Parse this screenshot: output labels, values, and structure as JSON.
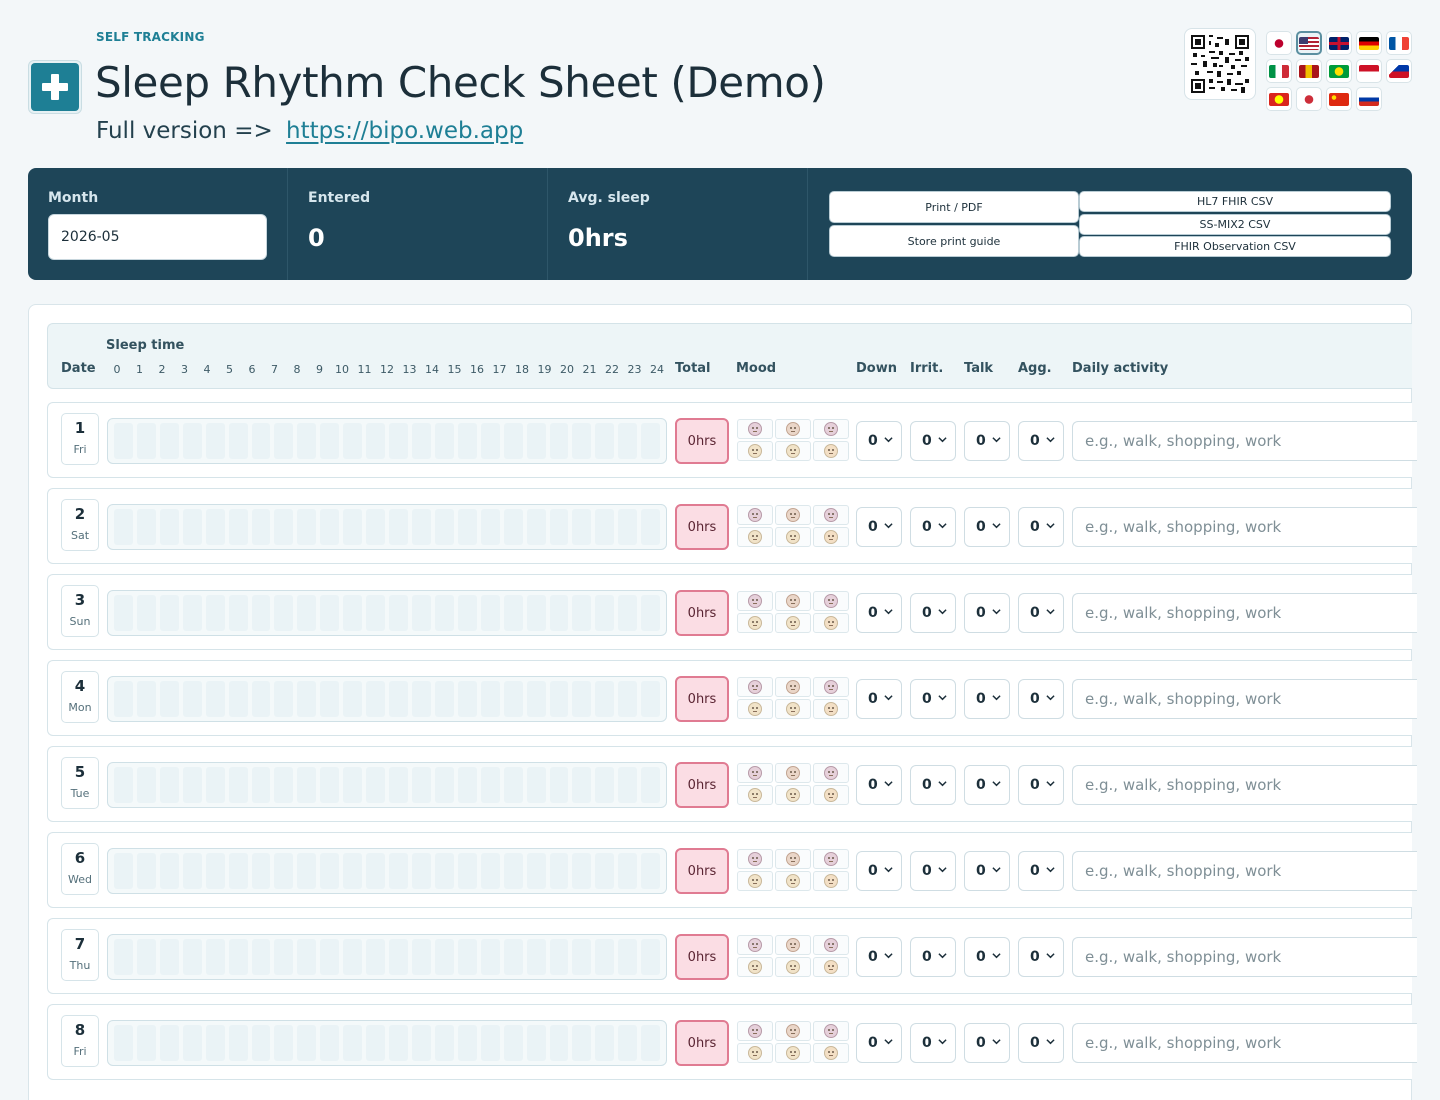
{
  "header": {
    "eyebrow": "SELF TRACKING",
    "title": "Sleep Rhythm Check Sheet (Demo)",
    "subtitle_prefix": "Full version =>",
    "subtitle_link": "https://bipo.web.app"
  },
  "languages": [
    {
      "code": "ja",
      "colors": [
        "#ffffff",
        "#bc002d"
      ]
    },
    {
      "code": "en-US",
      "colors": [
        "#b22234",
        "#3c3b6e"
      ],
      "selected": true
    },
    {
      "code": "en-GB",
      "colors": [
        "#012169",
        "#c8102e"
      ]
    },
    {
      "code": "de",
      "colors": [
        "#000000",
        "#dd0000",
        "#ffce00"
      ]
    },
    {
      "code": "fr",
      "colors": [
        "#0055a4",
        "#ffffff",
        "#ef4135"
      ]
    },
    {
      "code": "it",
      "colors": [
        "#009246",
        "#ffffff",
        "#ce2b37"
      ]
    },
    {
      "code": "es",
      "colors": [
        "#aa151b",
        "#f1bf00",
        "#aa151b"
      ]
    },
    {
      "code": "pt-BR",
      "colors": [
        "#009c3b",
        "#ffdf00"
      ]
    },
    {
      "code": "id",
      "colors": [
        "#ce1126",
        "#ffffff"
      ]
    },
    {
      "code": "fil",
      "colors": [
        "#0038a8",
        "#ce1126"
      ]
    },
    {
      "code": "vi",
      "colors": [
        "#da251d",
        "#ffff00"
      ]
    },
    {
      "code": "ko",
      "colors": [
        "#ffffff",
        "#cd2e3a"
      ]
    },
    {
      "code": "zh",
      "colors": [
        "#de2910",
        "#ffde00"
      ]
    },
    {
      "code": "ru",
      "colors": [
        "#ffffff",
        "#0039a6",
        "#d52b1e"
      ]
    }
  ],
  "summary": {
    "month_label": "Month",
    "month_value": "2026-05",
    "entered_label": "Entered",
    "entered_value": "0",
    "avg_label": "Avg. sleep",
    "avg_value": "0hrs",
    "buttons": {
      "print_pdf": "Print / PDF",
      "store_print_guide": "Store print guide",
      "hl7_fhir_csv": "HL7 FHIR CSV",
      "ss_mix2_csv": "SS-MIX2 CSV",
      "fhir_observation_csv": "FHIR Observation CSV"
    }
  },
  "table": {
    "headers": {
      "date": "Date",
      "sleep_time": "Sleep time",
      "total": "Total",
      "mood": "Mood",
      "down": "Down",
      "irrit": "Irrit.",
      "talk": "Talk",
      "agg": "Agg.",
      "daily_activity": "Daily activity"
    },
    "hours": [
      "0",
      "1",
      "2",
      "3",
      "4",
      "5",
      "6",
      "7",
      "8",
      "9",
      "10",
      "11",
      "12",
      "13",
      "14",
      "15",
      "16",
      "17",
      "18",
      "19",
      "20",
      "21",
      "22",
      "23",
      "24"
    ],
    "activity_placeholder": "e.g., walk, shopping, work",
    "rows": [
      {
        "day": "1",
        "weekday": "Fri",
        "total": "0hrs",
        "down": "0",
        "irrit": "0",
        "talk": "0",
        "agg": "0"
      },
      {
        "day": "2",
        "weekday": "Sat",
        "total": "0hrs",
        "down": "0",
        "irrit": "0",
        "talk": "0",
        "agg": "0"
      },
      {
        "day": "3",
        "weekday": "Sun",
        "total": "0hrs",
        "down": "0",
        "irrit": "0",
        "talk": "0",
        "agg": "0"
      },
      {
        "day": "4",
        "weekday": "Mon",
        "total": "0hrs",
        "down": "0",
        "irrit": "0",
        "talk": "0",
        "agg": "0"
      },
      {
        "day": "5",
        "weekday": "Tue",
        "total": "0hrs",
        "down": "0",
        "irrit": "0",
        "talk": "0",
        "agg": "0"
      },
      {
        "day": "6",
        "weekday": "Wed",
        "total": "0hrs",
        "down": "0",
        "irrit": "0",
        "talk": "0",
        "agg": "0"
      },
      {
        "day": "7",
        "weekday": "Thu",
        "total": "0hrs",
        "down": "0",
        "irrit": "0",
        "talk": "0",
        "agg": "0"
      },
      {
        "day": "8",
        "weekday": "Fri",
        "total": "0hrs",
        "down": "0",
        "irrit": "0",
        "talk": "0",
        "agg": "0"
      }
    ],
    "mood_icons": [
      "surprised-face-icon",
      "distressed-face-icon",
      "sad-face-icon",
      "neutral-face-icon",
      "calm-face-icon",
      "happy-face-icon"
    ]
  },
  "colors": {
    "accent": "#1e7f95",
    "summary_bg": "#1e4558",
    "total_bg": "#fbdde4",
    "total_border": "#e07b92"
  }
}
